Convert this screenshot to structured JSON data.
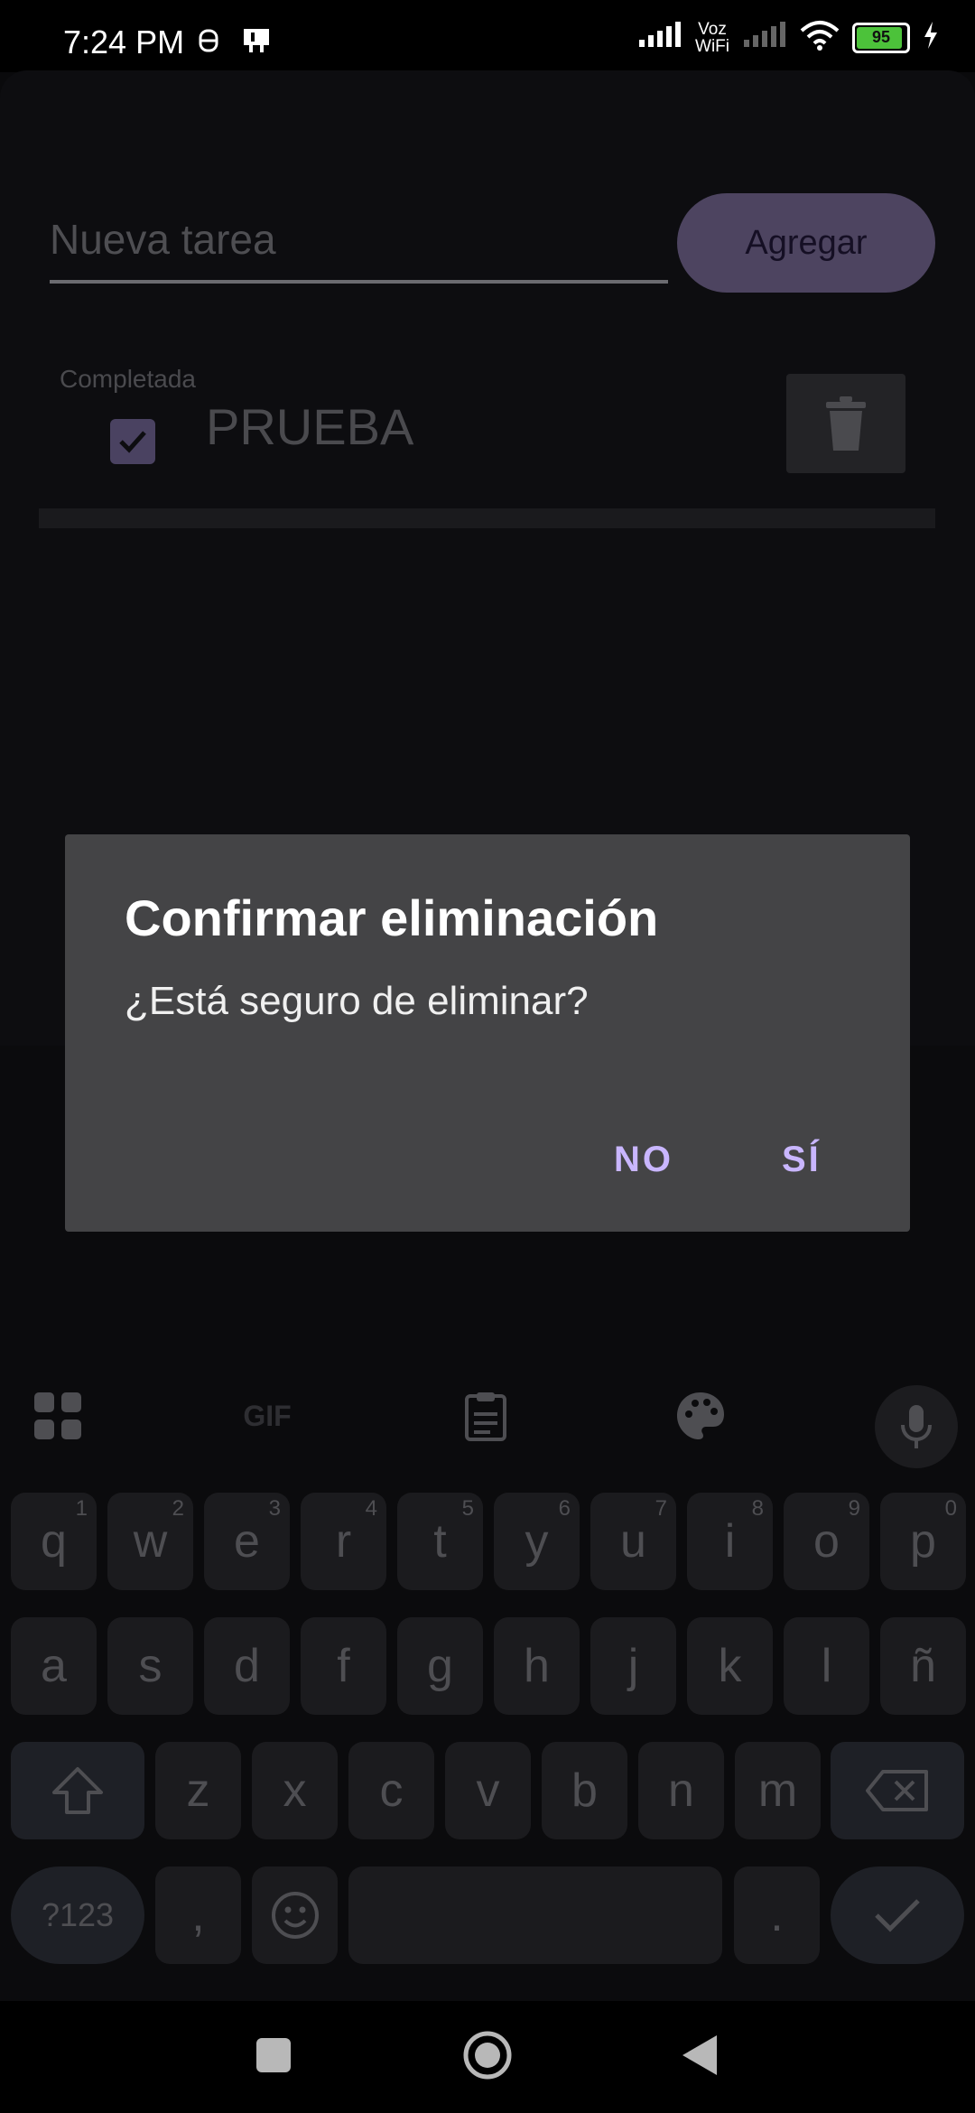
{
  "status_bar": {
    "time": "7:24 PM",
    "voz": "Voz",
    "wifi_label": "WiFi",
    "battery": "95"
  },
  "app": {
    "input_placeholder": "Nueva tarea",
    "add_button": "Agregar",
    "task": {
      "completed_label": "Completada",
      "title": "PRUEBA",
      "checked": true
    }
  },
  "dialog": {
    "title": "Confirmar eliminación",
    "message": "¿Está seguro de eliminar?",
    "no_button": "NO",
    "yes_button": "SÍ"
  },
  "keyboard": {
    "toolbar": {
      "gif": "GIF"
    },
    "row1": [
      "q",
      "w",
      "e",
      "r",
      "t",
      "y",
      "u",
      "i",
      "o",
      "p"
    ],
    "row1_hints": [
      "1",
      "2",
      "3",
      "4",
      "5",
      "6",
      "7",
      "8",
      "9",
      "0"
    ],
    "row2": [
      "a",
      "s",
      "d",
      "f",
      "g",
      "h",
      "j",
      "k",
      "l",
      "ñ"
    ],
    "row3": [
      "z",
      "x",
      "c",
      "v",
      "b",
      "n",
      "m"
    ],
    "symbols_key": "?123",
    "comma": ",",
    "period": "."
  },
  "colors": {
    "accent": "#c9b6ff",
    "dialog_bg": "#444446",
    "add_button_bg": "#4d4460"
  }
}
